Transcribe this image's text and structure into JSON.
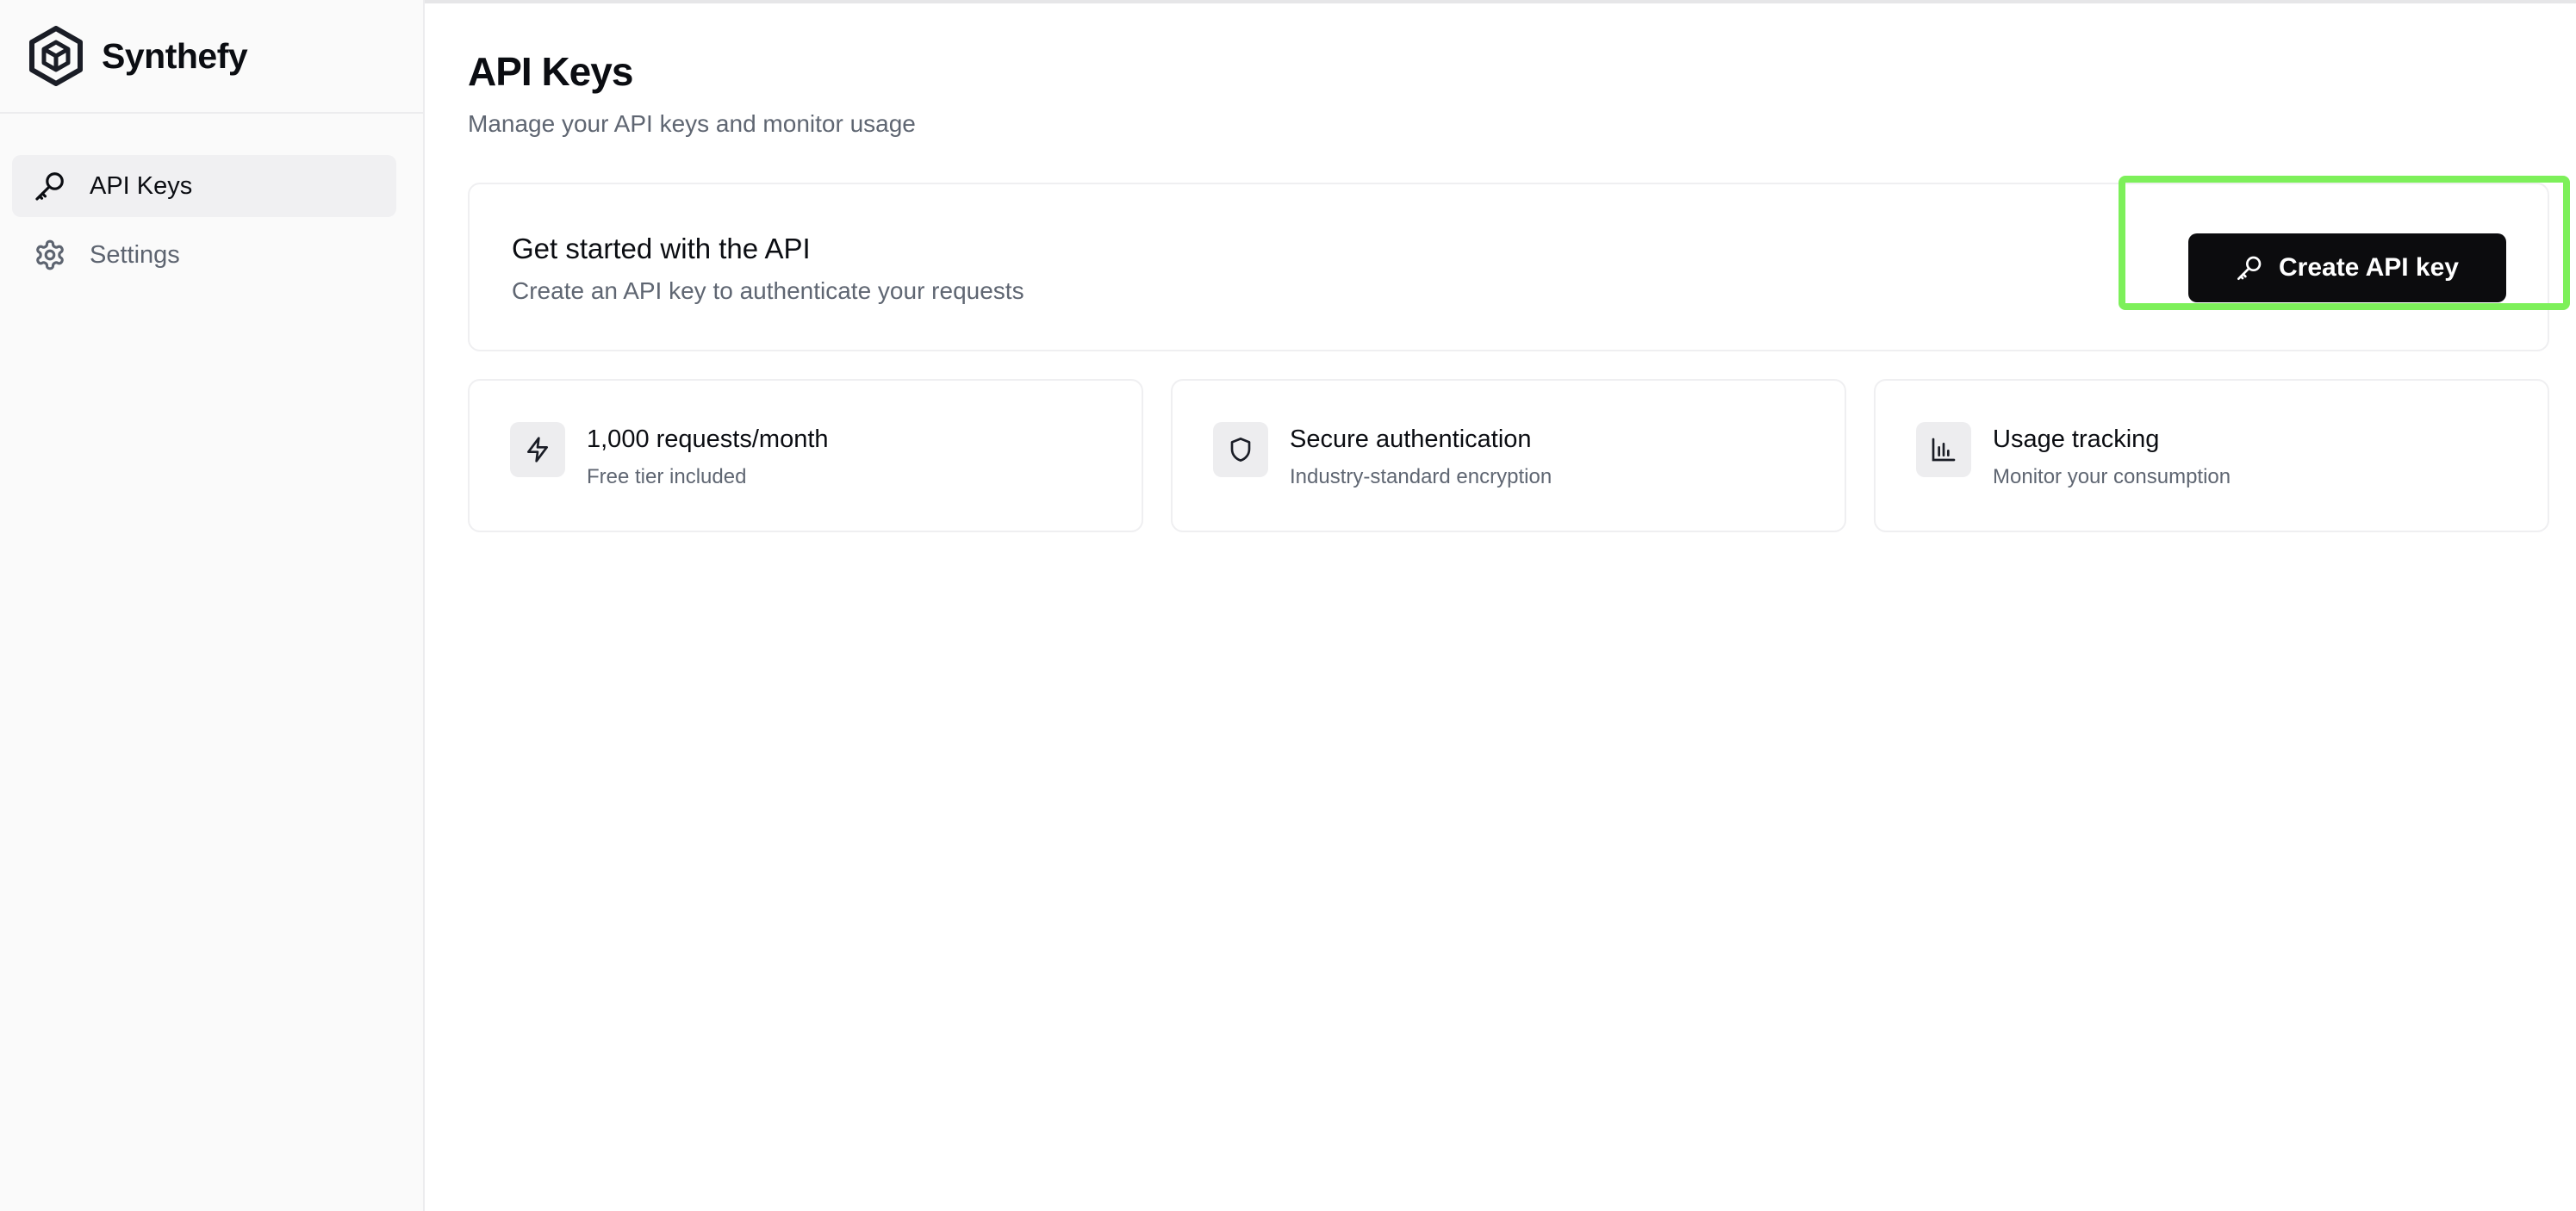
{
  "sidebar": {
    "brand": {
      "name": "Synthefy",
      "logo_icon": "hexagon-cube-logo"
    },
    "items": [
      {
        "label": "API Keys",
        "icon": "key-icon",
        "active": true
      },
      {
        "label": "Settings",
        "icon": "gear-icon",
        "active": false
      }
    ]
  },
  "main": {
    "title": "API Keys",
    "subtitle": "Manage your API keys and monitor usage",
    "hero": {
      "title": "Get started with the API",
      "subtitle": "Create an API key to authenticate your requests",
      "button_label": "Create API key",
      "button_icon": "key-icon",
      "highlight_color": "#7df05a"
    },
    "features": [
      {
        "title": "1,000 requests/month",
        "subtitle": "Free tier included",
        "icon": "lightning-icon"
      },
      {
        "title": "Secure authentication",
        "subtitle": "Industry-standard encryption",
        "icon": "shield-icon"
      },
      {
        "title": "Usage tracking",
        "subtitle": "Monitor your consumption",
        "icon": "bar-chart-icon"
      }
    ]
  },
  "colors": {
    "primary_button": "#0c0c0e",
    "sidebar_bg": "#fafafa",
    "muted_text": "#5f6672"
  }
}
